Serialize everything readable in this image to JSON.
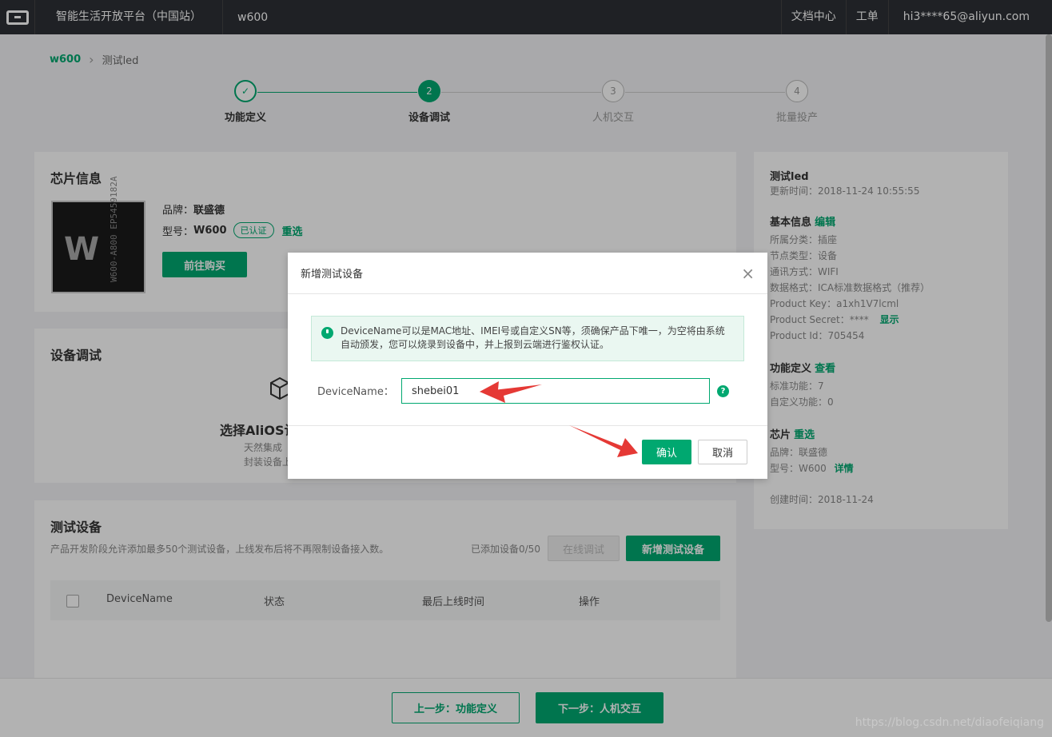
{
  "topbar": {
    "title": "智能生活开放平台（中国站）",
    "product": "w600",
    "links": [
      "文档中心",
      "工单",
      "hi3****65@aliyun.com"
    ]
  },
  "breadcrumb": {
    "parent": "w600",
    "current": "测试led"
  },
  "steps": [
    {
      "num": "",
      "label": "功能定义",
      "state": "done"
    },
    {
      "num": "2",
      "label": "设备调试",
      "state": "active"
    },
    {
      "num": "3",
      "label": "人机交互",
      "state": "todo"
    },
    {
      "num": "4",
      "label": "批量投产",
      "state": "todo"
    }
  ],
  "chip_card": {
    "title": "芯片信息",
    "brand_label": "品牌：",
    "brand": "联盛德",
    "model_label": "型号：",
    "model": "W600",
    "certified_badge": "已认证",
    "reselect": "重选",
    "buy_button": "前往购买",
    "chip_marking": "W600-A800 EP5459182A"
  },
  "debug_card": {
    "title": "设备调试",
    "select_title": "选择AliOS认",
    "desc_line1": "天然集成",
    "desc_line2": "封装设备上"
  },
  "test_devices": {
    "title": "测试设备",
    "subtitle": "产品开发阶段允许添加最多50个测试设备，上线发布后将不再限制设备接入数。",
    "count": "已添加设备0/50",
    "online_debug": "在线调试",
    "add_button": "新增测试设备",
    "columns": [
      "DeviceName",
      "状态",
      "最后上线时间",
      "操作"
    ]
  },
  "info_panel": {
    "name": "测试led",
    "updated": "更新时间：2018-11-24 10:55:55",
    "basic_title": "基本信息",
    "edit": "编辑",
    "lines": [
      "所属分类：插座",
      "节点类型：设备",
      "通讯方式：WIFI",
      "数据格式：ICA标准数据格式（推荐）",
      "Product Key：a1xh1V7lcml"
    ],
    "secret_label": "Product Secret：****",
    "show": "显示",
    "product_id": "Product Id：705454",
    "func_title": "功能定义",
    "view": "查看",
    "func_lines": [
      "标准功能：7",
      "自定义功能：0"
    ],
    "chip_title": "芯片",
    "chip_reselect": "重选",
    "chip_brand": "品牌：联盛德",
    "chip_model": "型号：W600",
    "detail": "详情",
    "created": "创建时间：2018-11-24"
  },
  "footer": {
    "prev": "上一步：功能定义",
    "next": "下一步：人机交互"
  },
  "modal": {
    "title": "新增测试设备",
    "tip": "DeviceName可以是MAC地址、IMEI号或自定义SN等，须确保产品下唯一，为空将由系统自动颁发，您可以烧录到设备中，并上报到云端进行鉴权认证。",
    "field_label": "DeviceName：",
    "field_value": "shebei01",
    "confirm": "确认",
    "cancel": "取消"
  },
  "watermark": "https://blog.csdn.net/diaofeiqiang",
  "colors": {
    "accent": "#00a870",
    "topbar": "#2d3035",
    "arrow": "#e53935"
  }
}
